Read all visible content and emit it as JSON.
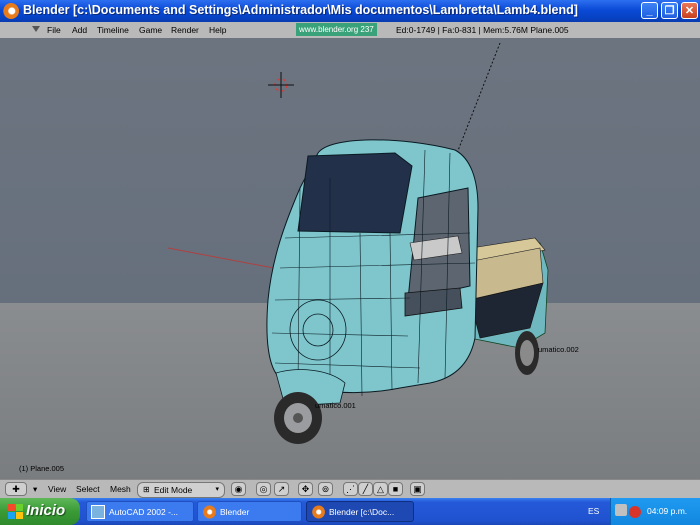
{
  "window": {
    "title": "Blender [c:\\Documents and Settings\\Administrador\\Mis documentos\\Lambretta\\Lamb4.blend]",
    "minimize": "_",
    "restore": "❐",
    "close": "✕"
  },
  "menubar": {
    "items": [
      "File",
      "Add",
      "Timeline",
      "Game",
      "Render",
      "Help"
    ],
    "logo_text": "www.blender.org 237",
    "stats": "Ed:0-1749 | Fa:0-831 | Mem:5.76M Plane.005"
  },
  "viewport": {
    "object_labels": [
      "umatico.002",
      "umatico.001"
    ],
    "frame_info": "(1) Plane.005"
  },
  "toolbar": {
    "view": "View",
    "select": "Select",
    "mesh": "Mesh",
    "mode": "Edit Mode"
  },
  "taskbar": {
    "start": "Inicio",
    "tasks": [
      "AutoCAD 2002 -...",
      "Blender",
      "Blender [c:\\Doc..."
    ],
    "language": "ES",
    "clock": "04:09 p.m."
  },
  "colors": {
    "titlebar": "#0a4ad6",
    "body_mesh": "#7ec6cc",
    "seat": "#c8b98f",
    "start_button": "#3a9a35"
  }
}
